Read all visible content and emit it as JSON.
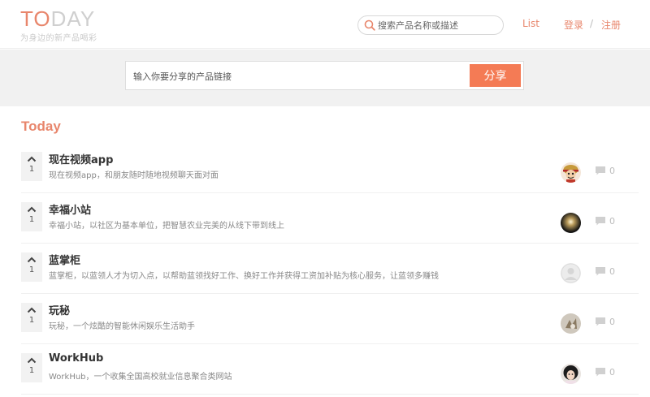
{
  "header": {
    "logo_accent": "TO",
    "logo_rest": "DAY",
    "slogan": "为身边的新产品喝彩",
    "search_placeholder": "搜索产品名称或描述",
    "nav_list": "List",
    "nav_login": "登录",
    "nav_separator": "/",
    "nav_register": "注册"
  },
  "share": {
    "placeholder": "输入你要分享的产品链接",
    "button_label": "分享"
  },
  "section_title": "Today",
  "colors": {
    "accent": "#e8866c",
    "button": "#f47b55"
  },
  "products": [
    {
      "title": "现在视频app",
      "desc": "现在视频app，和朋友随时随地视频聊天面对面",
      "votes": "1",
      "comments": "0",
      "avatar": "anime-avatar"
    },
    {
      "title": "幸福小站",
      "desc": "幸福小站，以社区为基本单位，把智慧农业完美的从线下带到线上",
      "votes": "1",
      "comments": "0",
      "avatar": "dark-light-avatar"
    },
    {
      "title": "蓝掌柜",
      "desc": "蓝掌柜，以蓝领人才为切入点，以帮助蓝领找好工作、换好工作并获得工资加补贴为核心服务，让蓝领多赚钱",
      "votes": "1",
      "comments": "0",
      "avatar": "default-avatar"
    },
    {
      "title": "玩秘",
      "desc": "玩秘，一个炫酷的智能休闲娱乐生活助手",
      "votes": "1",
      "comments": "0",
      "avatar": "photo-avatar"
    },
    {
      "title": "WorkHub",
      "desc": "WorkHub，一个收集全国高校就业信息聚合类网站",
      "votes": "1",
      "comments": "0",
      "avatar": "person-avatar"
    }
  ]
}
